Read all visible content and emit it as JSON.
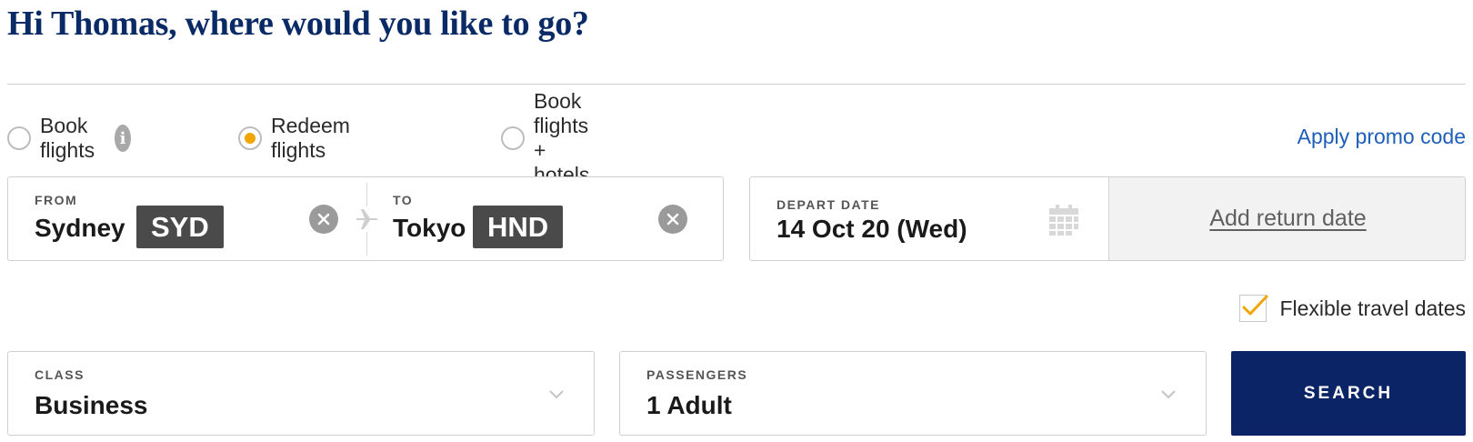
{
  "greeting": "Hi Thomas, where would you like to go?",
  "trip_type": {
    "options": [
      {
        "label": "Book flights",
        "selected": false,
        "has_info_icon": true
      },
      {
        "label": "Redeem flights",
        "selected": true
      },
      {
        "label": "Book flights + hotels",
        "selected": false
      }
    ],
    "info_icon_glyph": "i"
  },
  "promo_link": "Apply promo code",
  "route": {
    "from": {
      "label": "FROM",
      "city": "Sydney",
      "code": "SYD"
    },
    "to": {
      "label": "TO",
      "city": "Tokyo",
      "code": "HND"
    }
  },
  "dates": {
    "depart_label": "DEPART DATE",
    "depart_value": "14 Oct 20 (Wed)",
    "return_link": "Add return date"
  },
  "flexible_dates": {
    "label": "Flexible travel dates",
    "checked": true
  },
  "class_select": {
    "label": "CLASS",
    "value": "Business"
  },
  "passengers_select": {
    "label": "PASSENGERS",
    "value": "1 Adult"
  },
  "search_button": "SEARCH",
  "colors": {
    "heading": "#0a2a66",
    "radio_selected": "#f0a500",
    "checkmark": "#f0a500",
    "link": "#1d5fb8",
    "code_badge": "#4a4a4a",
    "search_button": "#0b2466"
  },
  "icons": [
    "info-icon",
    "plane-icon",
    "close-icon",
    "calendar-icon",
    "checkmark-icon",
    "chevron-down-icon"
  ]
}
